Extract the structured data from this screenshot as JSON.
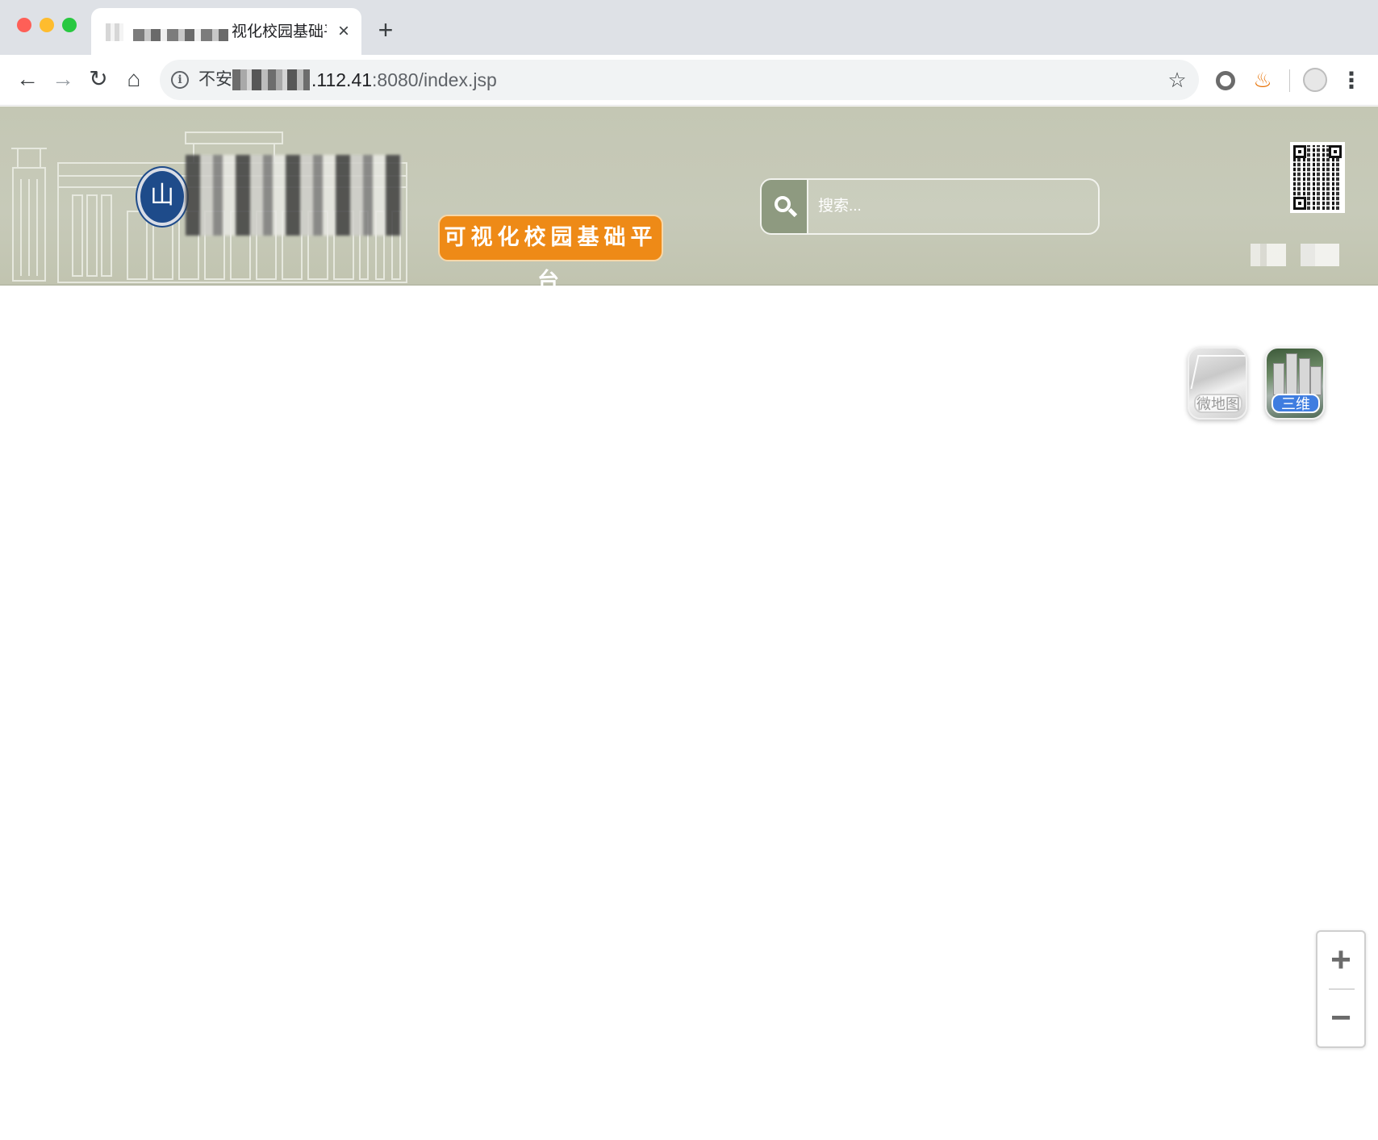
{
  "browser": {
    "tab": {
      "title": "视化校园基础平",
      "close_label": "×"
    },
    "new_tab_label": "+",
    "toolbar": {
      "back_label": "←",
      "forward_label": "→",
      "reload_label": "↻",
      "home_label": "⌂",
      "security_text": "不安",
      "url_host": ".112.41",
      "url_path": ":8080/index.jsp",
      "bookmark_label": "☆",
      "menu_label": "⋮",
      "java_label": "♨",
      "info_label": "i"
    }
  },
  "header": {
    "logo_glyph": "山",
    "platform_name": "可视化校园基础平台",
    "search": {
      "placeholder": "搜索..."
    },
    "colors": {
      "header_bg": "#c4c7b4",
      "badge": "#ee8a17",
      "search_btn": "#8e9a80"
    }
  },
  "map": {
    "layers": [
      {
        "label": "微地图",
        "icon": "micromap-icon"
      },
      {
        "label": "三维",
        "icon": "3d-buildings-icon"
      }
    ],
    "zoom": {
      "in_label": "+",
      "out_label": "−"
    }
  }
}
